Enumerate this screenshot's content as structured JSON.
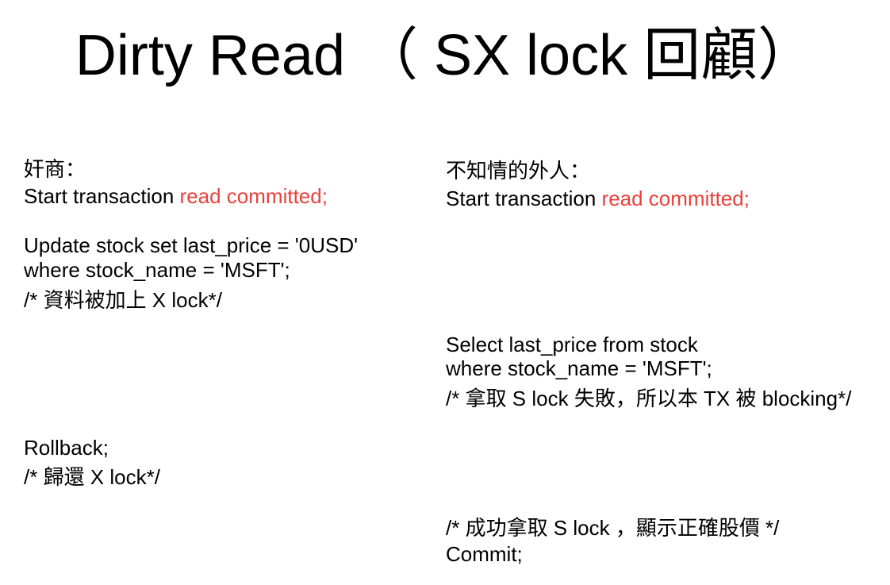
{
  "title": "Dirty Read （ SX lock 回顧）",
  "left": {
    "heading": "奸商：",
    "start_prefix": "Start transaction ",
    "start_isolation": "read committed;",
    "update_line1": "Update stock set last_price = '0USD'",
    "update_line2": "where stock_name = 'MSFT';",
    "update_comment": "/*  資料被加上 X lock*/",
    "rollback": "Rollback;",
    "rollback_comment": "/* 歸還 X lock*/"
  },
  "right": {
    "heading": "不知情的外人：",
    "start_prefix": "Start transaction ",
    "start_isolation": "read committed;",
    "select_line1": "Select last_price from stock",
    "select_line2": "where stock_name = 'MSFT';",
    "select_comment": "/* 拿取 S lock 失敗，所以本 TX 被 blocking*/",
    "success_comment": "/*  成功拿取 S lock ，顯示正確股價 */",
    "commit": "Commit;"
  },
  "colors": {
    "highlight": "#e8413a",
    "text": "#000000",
    "background": "#ffffff"
  }
}
